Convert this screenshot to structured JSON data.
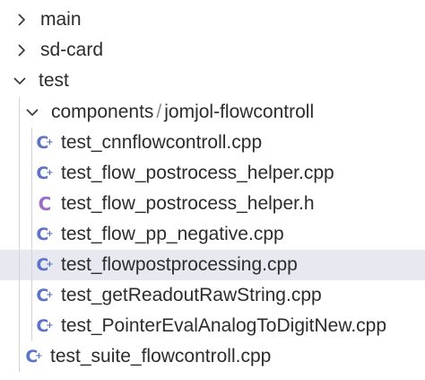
{
  "tree": {
    "folders": {
      "main": "main",
      "sd_card": "sd-card",
      "test": "test",
      "components": "components",
      "separator": "/",
      "jomjol": "jomjol-flowcontroll"
    },
    "files": [
      {
        "name": "test_cnnflowcontroll.cpp",
        "icon": "cpp-icon"
      },
      {
        "name": "test_flow_postrocess_helper.cpp",
        "icon": "cpp-icon"
      },
      {
        "name": "test_flow_postrocess_helper.h",
        "icon": "h-icon"
      },
      {
        "name": "test_flow_pp_negative.cpp",
        "icon": "cpp-icon"
      },
      {
        "name": "test_flowpostprocessing.cpp",
        "icon": "cpp-icon",
        "selected": true
      },
      {
        "name": "test_getReadoutRawString.cpp",
        "icon": "cpp-icon"
      },
      {
        "name": "test_PointerEvalAnalogToDigitNew.cpp",
        "icon": "cpp-icon"
      }
    ],
    "suite_file": {
      "name": "test_suite_flowcontroll.cpp",
      "icon": "cpp-icon"
    }
  },
  "colors": {
    "selection": "#e8e8f0",
    "cpp_icon": "#5b73c9",
    "h_icon": "#9b6bc8",
    "text": "#2c2c2c",
    "indent_guide": "#d4d4d4"
  }
}
